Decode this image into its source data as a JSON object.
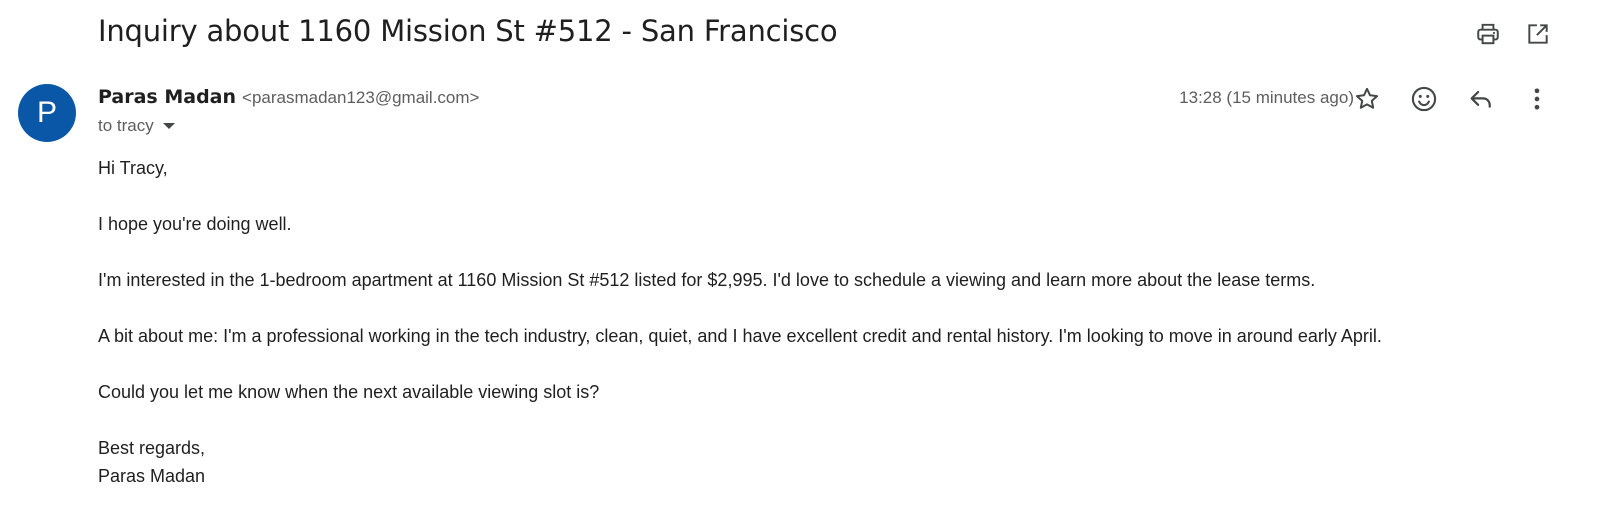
{
  "email": {
    "subject": "Inquiry about 1160 Mission St #512 - San Francisco",
    "toolbar": {
      "print_icon": "print-icon",
      "open_new_window_icon": "open-in-new-window-icon"
    },
    "sender": {
      "avatar_letter": "P",
      "avatar_color": "#0b57a7",
      "name": "Paras Madan",
      "email": "<parasmadan123@gmail.com>"
    },
    "recipient_label": "to tracy",
    "timestamp": "13:28 (15 minutes ago)",
    "actions": [
      "star-icon",
      "emoji-reaction-icon",
      "reply-icon",
      "more-options-icon"
    ],
    "body": {
      "greeting": "Hi Tracy,",
      "para1": "I hope you're doing well.",
      "para2": "I'm interested in the 1-bedroom apartment at 1160 Mission St #512 listed for $2,995. I'd love to schedule a viewing and learn more about the lease terms.",
      "para3": "A bit about me: I'm a professional working in the tech industry, clean, quiet, and I have excellent credit and rental history. I'm looking to move in around early April.",
      "para4": "Could you let me know when the next available viewing slot is?",
      "closing": "Best regards,",
      "signature": "Paras Madan"
    }
  }
}
